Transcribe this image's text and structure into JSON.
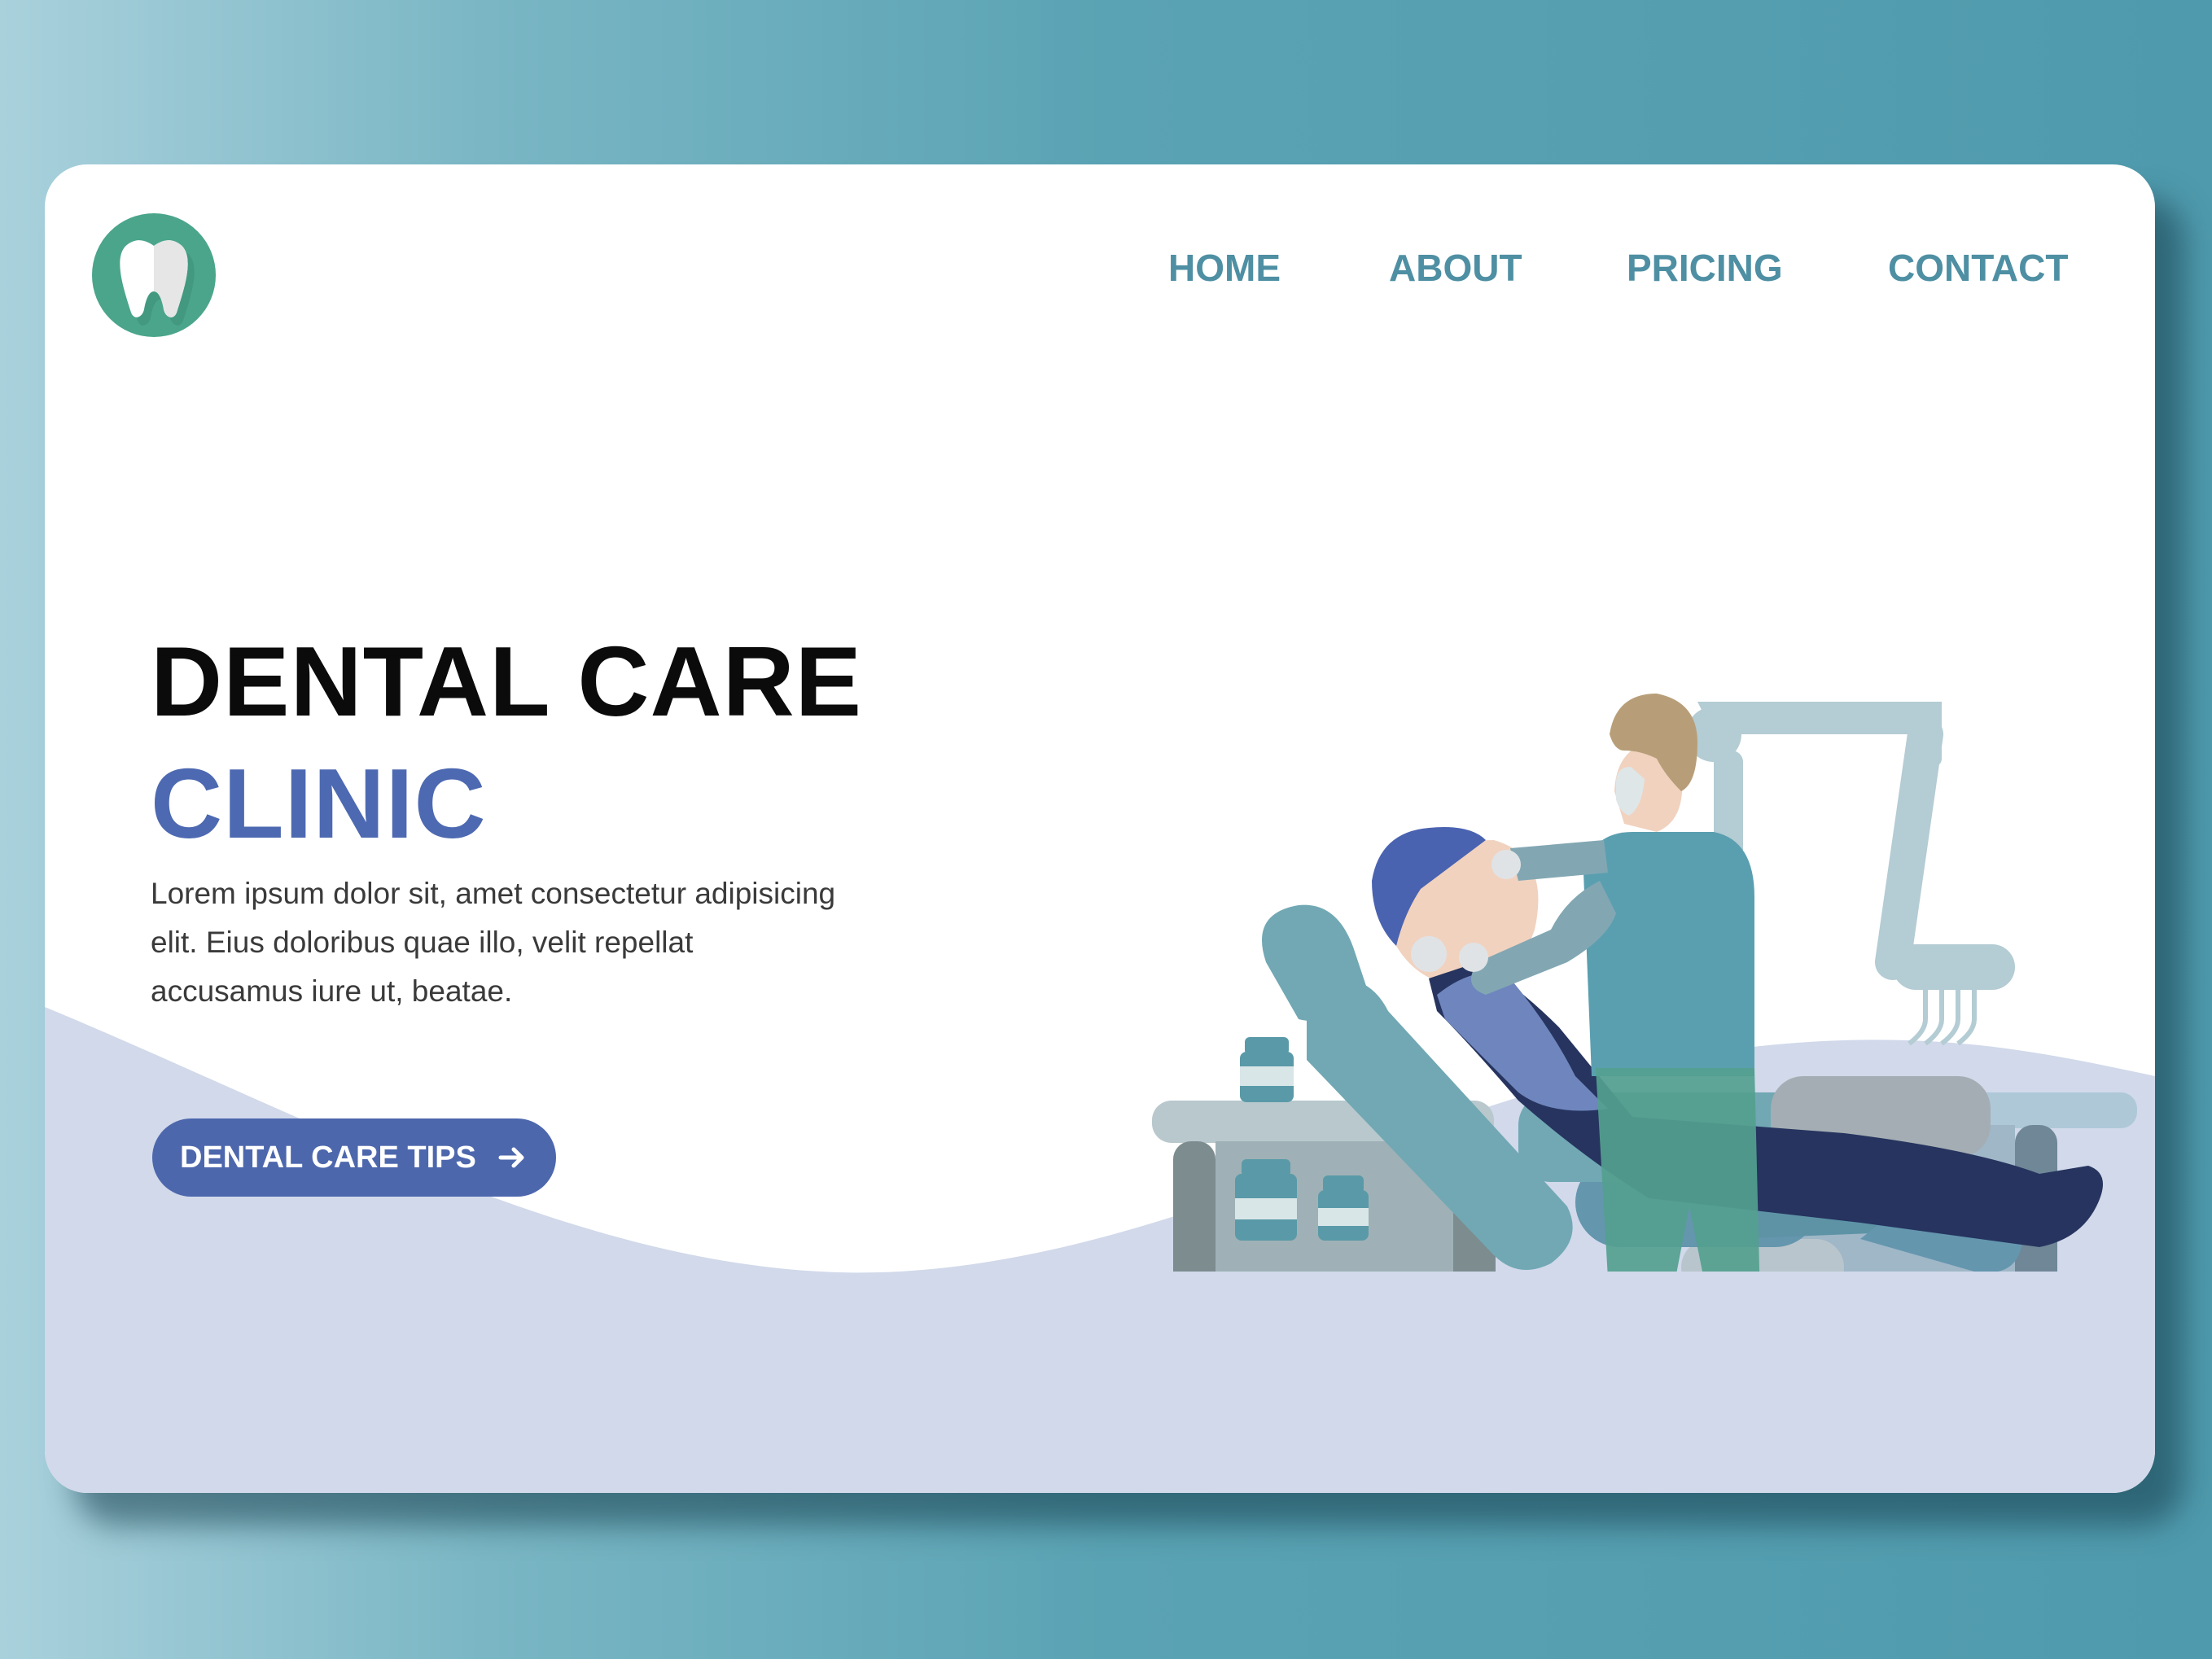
{
  "brand": {
    "logo_icon": "tooth-icon",
    "logo_color": "#4aa58b"
  },
  "nav": {
    "items": [
      {
        "label": "HOME"
      },
      {
        "label": "ABOUT"
      },
      {
        "label": "PRICING"
      },
      {
        "label": "CONTACT"
      }
    ]
  },
  "hero": {
    "title_line1": "DENTAL CARE",
    "title_line2": "CLINIC",
    "description": "Lorem ipsum dolor sit, amet consectetur adipisicing elit. Eius doloribus quae illo, velit repellat accusamus iure ut, beatae.",
    "cta_label": "DENTAL CARE TIPS",
    "cta_icon": "arrow-right-icon"
  },
  "illustration": {
    "name": "dentist-treating-patient-illustration"
  },
  "colors": {
    "accent": "#4d67ad",
    "nav_text": "#4e8fa3",
    "wave": "#d1d9ea",
    "title": "#0b0b0b"
  }
}
